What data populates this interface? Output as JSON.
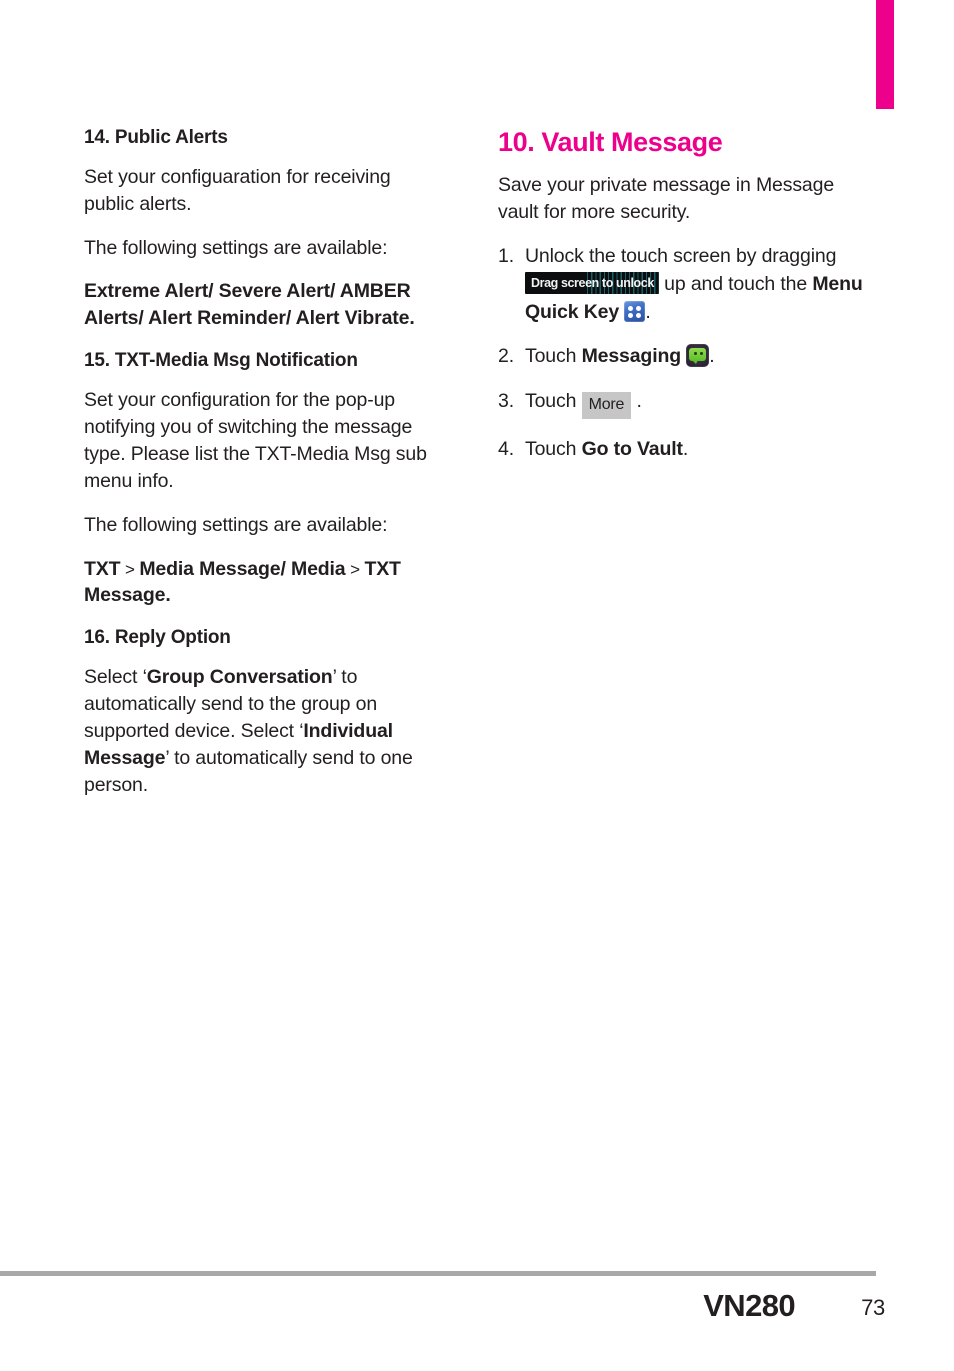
{
  "page": {
    "model": "VN280",
    "page_number": "73",
    "accent_color": "#ec008c",
    "rule_color": "#a8a8a8"
  },
  "left_column": {
    "sections": [
      {
        "title": "14. Public Alerts",
        "paragraphs": [
          {
            "text": "Set your configuaration for receiving public alerts.",
            "bold": false
          },
          {
            "text": "The following settings are available:",
            "bold": false
          },
          {
            "text": "Extreme Alert/ Severe Alert/ AMBER Alerts/ Alert Reminder/ Alert Vibrate.",
            "bold": true
          }
        ]
      },
      {
        "title": "15. TXT-Media Msg Notification",
        "paragraphs": [
          {
            "text": "Set your configuration for the pop-up notifying you of switching the message type. Please list the TXT-Media Msg sub menu info.",
            "bold": false
          },
          {
            "text": "The following settings are available:",
            "bold": false
          }
        ],
        "path_line": {
          "part1": "TXT",
          "sep1": ">",
          "part2": "Media Message/ Media",
          "sep2": ">",
          "part3": "TXT Message."
        }
      },
      {
        "title": "16. Reply Option",
        "reply_text": {
          "lead1": "Select ‘",
          "bold1": "Group Conversation",
          "mid1": "’ to automatically send to the group on supported device. Select ‘",
          "bold2": "Individual Message",
          "tail": "’ to automatically send to one person."
        }
      }
    ]
  },
  "right_column": {
    "chapter_title": "10. Vault Message",
    "intro": "Save your private message in Message vault for more security.",
    "steps": [
      {
        "num": "1.",
        "pre": "Unlock the touch screen by dragging ",
        "graphic": "drag-screen-to-unlock-bar",
        "graphic_label": "Drag screen to unlock",
        "mid": " up and touch the ",
        "bold": "Menu Quick Key",
        "icon": "menu-quick-key-icon",
        "post": "."
      },
      {
        "num": "2.",
        "pre": "Touch ",
        "bold": "Messaging",
        "icon": "messaging-icon",
        "post": "."
      },
      {
        "num": "3.",
        "pre": "Touch ",
        "button_label": "More",
        "post": "."
      },
      {
        "num": "4.",
        "pre": "Touch ",
        "bold": "Go to Vault",
        "post": "."
      }
    ]
  }
}
